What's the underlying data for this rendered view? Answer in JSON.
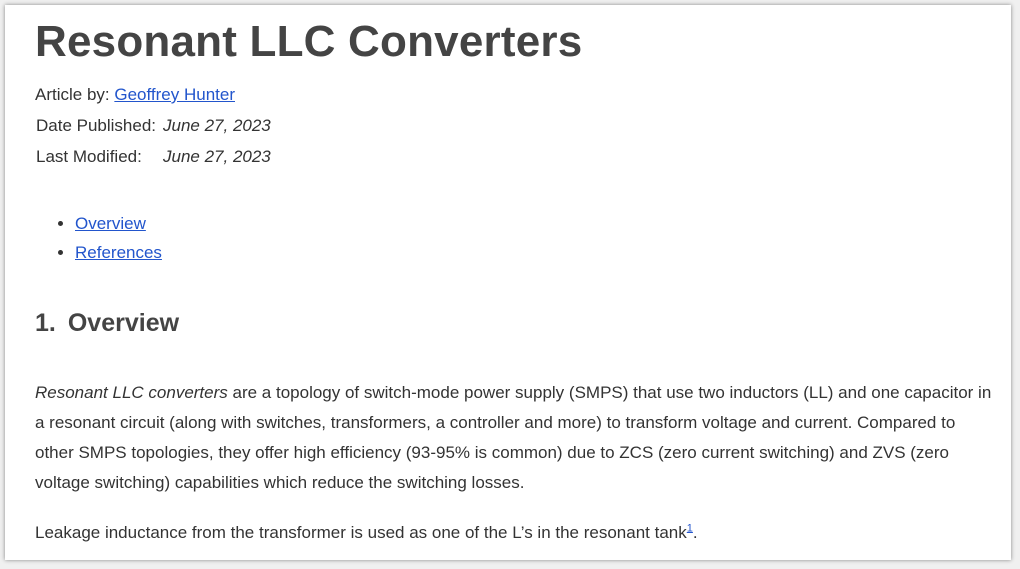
{
  "article": {
    "title": "Resonant LLC Converters",
    "author_label": "Article by: ",
    "author_name": "Geoffrey Hunter",
    "published_label": "Date Published:",
    "published_date": "June 27, 2023",
    "modified_label": "Last Modified:",
    "modified_date": "June 27, 2023"
  },
  "toc": {
    "items": [
      {
        "label": "Overview"
      },
      {
        "label": "References"
      }
    ]
  },
  "section": {
    "number": "1.",
    "title": "Overview"
  },
  "body": {
    "p1_italic": "Resonant LLC converters",
    "p1_rest": " are a topology of switch-mode power supply (SMPS) that use two inductors (LL) and one capacitor in a resonant circuit (along with switches, transformers, a controller and more) to transform voltage and current. Compared to other SMPS topologies, they offer high efficiency (93-95% is common) due to ZCS (zero current switching) and ZVS (zero voltage switching) capabilities which reduce the switching losses.",
    "p2_text": "Leakage inductance from the transformer is used as one of the L’s in the resonant tank",
    "p2_footnote": "1",
    "p2_end": "."
  }
}
